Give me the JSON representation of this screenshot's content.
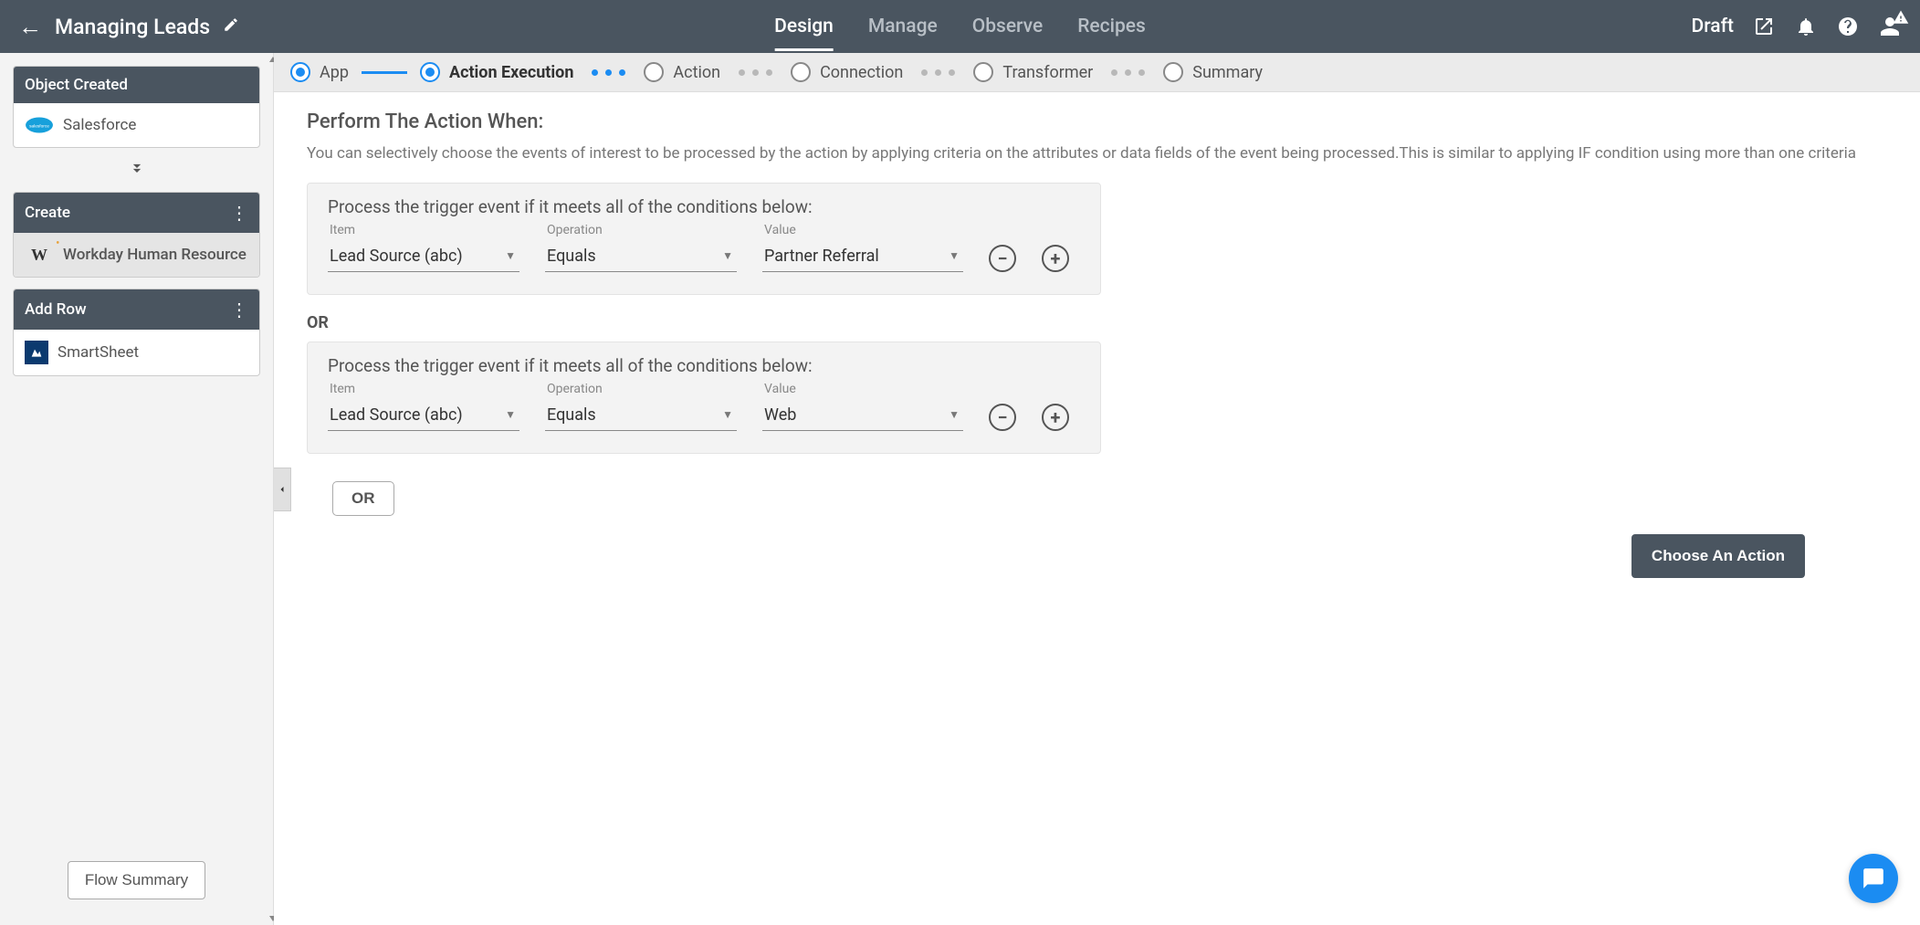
{
  "header": {
    "title": "Managing Leads",
    "status": "Draft",
    "tabs": [
      "Design",
      "Manage",
      "Observe",
      "Recipes"
    ],
    "activeTab": 0
  },
  "sidebar": {
    "cards": [
      {
        "title": "Object Created",
        "app": "Salesforce",
        "hasMenu": false,
        "highlighted": false
      },
      {
        "title": "Create",
        "app": "Workday Human Resource",
        "hasMenu": true,
        "highlighted": true
      },
      {
        "title": "Add Row",
        "app": "SmartSheet",
        "hasMenu": true,
        "highlighted": false
      }
    ],
    "flowSummaryLabel": "Flow Summary"
  },
  "stepper": {
    "steps": [
      {
        "label": "App",
        "state": "done"
      },
      {
        "label": "Action Execution",
        "state": "current"
      },
      {
        "label": "Action",
        "state": "pending"
      },
      {
        "label": "Connection",
        "state": "pending"
      },
      {
        "label": "Transformer",
        "state": "pending"
      },
      {
        "label": "Summary",
        "state": "pending"
      }
    ]
  },
  "form": {
    "heading": "Perform The Action When:",
    "description": "You can selectively choose the events of interest to be processed by the action by applying criteria on the attributes or data fields of the event being processed.This is similar to applying IF condition using more than one criteria",
    "blockTitle": "Process the trigger event if it meets all of the conditions below:",
    "labels": {
      "item": "Item",
      "operation": "Operation",
      "value": "Value"
    },
    "orLabel": "OR",
    "orButton": "OR",
    "blocks": [
      {
        "rows": [
          {
            "item": "Lead Source (abc)",
            "operation": "Equals",
            "value": "Partner Referral"
          }
        ]
      },
      {
        "rows": [
          {
            "item": "Lead Source (abc)",
            "operation": "Equals",
            "value": "Web"
          }
        ]
      }
    ],
    "chooseActionLabel": "Choose An Action"
  }
}
